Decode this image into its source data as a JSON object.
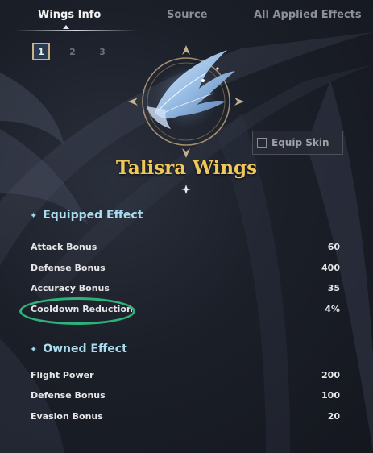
{
  "tabs": [
    {
      "label": "Wings Info",
      "active": true
    },
    {
      "label": "Source",
      "active": false
    },
    {
      "label": "All Applied Effects",
      "active": false
    }
  ],
  "pages": [
    "1",
    "2",
    "3"
  ],
  "equip_skin": {
    "label": "Equip Skin",
    "checked": false
  },
  "wings_name": "Talisra Wings",
  "equipped_effect": {
    "title": "Equipped Effect",
    "rows": [
      {
        "label": "Attack Bonus",
        "value": "60"
      },
      {
        "label": "Defense Bonus",
        "value": "400"
      },
      {
        "label": "Accuracy Bonus",
        "value": "35"
      },
      {
        "label": "Cooldown Reduction",
        "value": "4%"
      }
    ]
  },
  "owned_effect": {
    "title": "Owned Effect",
    "rows": [
      {
        "label": "Flight Power",
        "value": "200"
      },
      {
        "label": "Defense Bonus",
        "value": "100"
      },
      {
        "label": "Evasion Bonus",
        "value": "20"
      }
    ]
  },
  "colors": {
    "accent_gold": "#f0c85a",
    "section_cyan": "#a9dcee",
    "highlight_green": "#2fb27a"
  },
  "icons": [
    "wing-emblem-icon",
    "sparkle-icon",
    "checkbox-icon"
  ]
}
